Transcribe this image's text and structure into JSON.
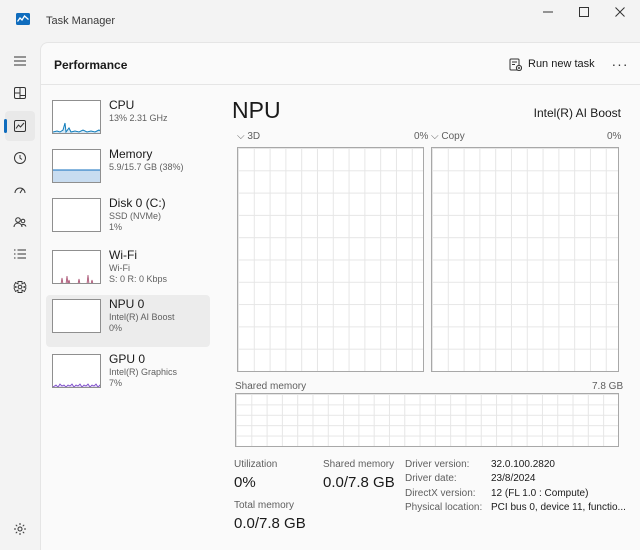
{
  "window": {
    "title": "Task Manager"
  },
  "nav": {
    "items": [
      {
        "name": "hamburger-menu-icon"
      },
      {
        "name": "processes-icon"
      },
      {
        "name": "performance-icon",
        "active": true
      },
      {
        "name": "app-history-icon"
      },
      {
        "name": "startup-apps-icon"
      },
      {
        "name": "users-icon"
      },
      {
        "name": "details-icon"
      },
      {
        "name": "services-icon"
      }
    ],
    "settings": {
      "name": "settings-icon"
    }
  },
  "header": {
    "title": "Performance",
    "run_new_task_label": "Run new task",
    "more_label": "···"
  },
  "devices": [
    {
      "name": "CPU",
      "line1": "13% 2.31 GHz",
      "line2": "",
      "color": "#117dbb",
      "selected": false
    },
    {
      "name": "Memory",
      "line1": "5.9/15.7 GB (38%)",
      "line2": "",
      "color": "#0f6cbd",
      "selected": false
    },
    {
      "name": "Disk 0 (C:)",
      "line1": "SSD (NVMe)",
      "line2": "1%",
      "color": "#4da60c",
      "selected": false
    },
    {
      "name": "Wi-Fi",
      "line1": "Wi-Fi",
      "line2": "S: 0 R: 0 Kbps",
      "color": "#a74f70",
      "selected": false
    },
    {
      "name": "NPU 0",
      "line1": "Intel(R) AI Boost",
      "line2": "0%",
      "color": "#6c6c6c",
      "selected": true
    },
    {
      "name": "GPU 0",
      "line1": "Intel(R) Graphics",
      "line2": "7%",
      "color": "#7340c5",
      "selected": false
    }
  ],
  "detail": {
    "title": "NPU",
    "device_name": "Intel(R) AI Boost",
    "graphs": [
      {
        "label": "3D",
        "value": "0%"
      },
      {
        "label": "Copy",
        "value": "0%"
      }
    ],
    "shared_memory_label": "Shared memory",
    "shared_memory_max": "7.8 GB",
    "stats": {
      "utilization_label": "Utilization",
      "utilization_value": "0%",
      "shared_memory_label": "Shared memory",
      "shared_memory_value": "0.0/7.8 GB",
      "total_memory_label": "Total memory",
      "total_memory_value": "0.0/7.8 GB"
    },
    "info": [
      {
        "key": "Driver version:",
        "value": "32.0.100.2820"
      },
      {
        "key": "Driver date:",
        "value": "23/8/2024"
      },
      {
        "key": "DirectX version:",
        "value": "12 (FL 1.0 : Compute)"
      },
      {
        "key": "Physical location:",
        "value": "PCI bus 0, device 11, functio..."
      }
    ]
  },
  "colors": {
    "accent": "#0f6cbd",
    "cpu_line": "#117dbb",
    "memory_fill": "#c8dcf0",
    "wifi_line": "#a74f70",
    "gpu_line": "#7340c5"
  }
}
